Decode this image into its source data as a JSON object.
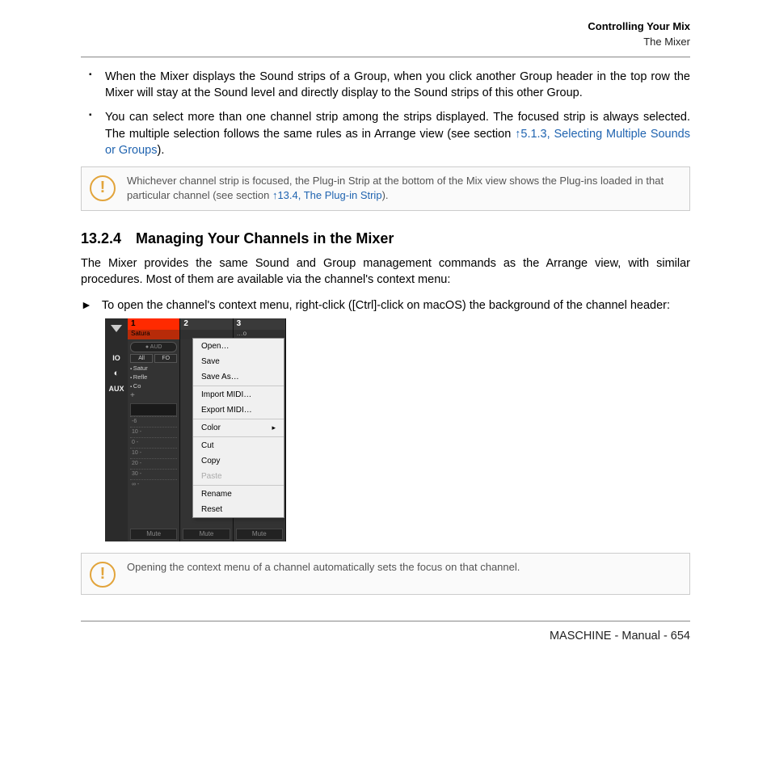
{
  "header": {
    "title": "Controlling Your Mix",
    "subtitle": "The Mixer"
  },
  "bullets": {
    "b1": "When the Mixer displays the Sound strips of a Group, when you click another Group header in the top row the Mixer will stay at the Sound level and directly display to the Sound strips of this other Group.",
    "b2a": "You can select more than one channel strip among the strips displayed. The focused strip is always selected. The multiple selection follows the same rules as in Arrange view (see section ",
    "b2link": "↑5.1.3, Selecting Multiple Sounds or Groups",
    "b2b": ")."
  },
  "note1": {
    "a": "Whichever channel strip is focused, the Plug-in Strip at the bottom of the Mix view shows the Plug-ins loaded in that particular channel (see section ",
    "link": "↑13.4, The Plug-in Strip",
    "b": ")."
  },
  "section": {
    "num": "13.2.4",
    "title": "Managing Your Channels in the Mixer"
  },
  "intro": "The Mixer provides the same Sound and Group management commands as the Arrange view, with similar procedures. Most of them are available via the channel's context menu:",
  "step1": "To open the channel's context menu, right-click ([Ctrl]-click on macOS) the background of the channel header:",
  "note2": "Opening the context menu of a channel automatically sets the focus on that channel.",
  "footer": "MASCHINE - Manual - 654",
  "shot": {
    "side": {
      "io": "IO",
      "plug": "⬤",
      "aux": "AUX"
    },
    "cols": {
      "c1": "1",
      "c2": "2",
      "c3": "3",
      "n1": "Satura",
      "aud": "AUD",
      "all": "All",
      "fo": "FO",
      "p1": "Satur",
      "p2": "Refle",
      "p3": "Co",
      "scale": [
        "-6",
        "10 -",
        "0 -",
        "10 -",
        "20 -",
        "30 -",
        "∞ -"
      ],
      "mute": "Mute"
    },
    "menu": [
      "Open…",
      "Save",
      "Save As…",
      "-",
      "Import MIDI…",
      "Export MIDI…",
      "-",
      "Color>",
      "-",
      "Cut",
      "Copy",
      "Paste*",
      "-",
      "Rename",
      "Reset"
    ]
  }
}
